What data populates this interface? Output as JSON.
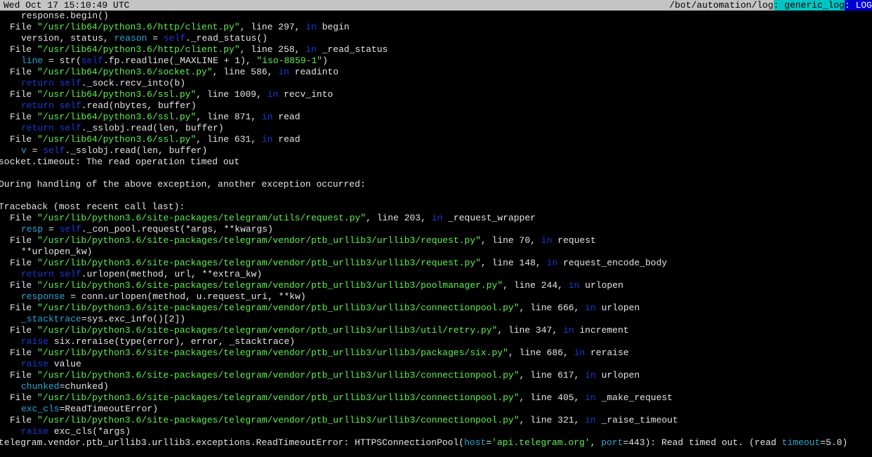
{
  "status_bar": {
    "datetime": "Wed Oct 17 15:10:49 UTC",
    "path": "/bot/automation/log",
    "sep1": ":",
    "window": " generic_log",
    "sep2": ":",
    "tag": " LOG"
  },
  "colors": {
    "string": "#5ff050",
    "keyword": "#1a3ad8",
    "variable": "#2aa8d8",
    "text": "#e5e5e5",
    "background": "#000000"
  },
  "lines": [
    {
      "indent": 4,
      "parts": [
        {
          "t": "response.begin()"
        }
      ]
    },
    {
      "indent": 2,
      "parts": [
        {
          "t": "File "
        },
        {
          "t": "\"/usr/lib64/python3.6/http/client.py\"",
          "c": "str"
        },
        {
          "t": ", line 297, "
        },
        {
          "t": "in",
          "c": "kw"
        },
        {
          "t": " begin"
        }
      ]
    },
    {
      "indent": 4,
      "parts": [
        {
          "t": "version, status, "
        },
        {
          "t": "reason",
          "c": "var"
        },
        {
          "t": " = "
        },
        {
          "t": "self",
          "c": "self"
        },
        {
          "t": "._read_status()"
        }
      ]
    },
    {
      "indent": 2,
      "parts": [
        {
          "t": "File "
        },
        {
          "t": "\"/usr/lib64/python3.6/http/client.py\"",
          "c": "str"
        },
        {
          "t": ", line 258, "
        },
        {
          "t": "in",
          "c": "kw"
        },
        {
          "t": " _read_status"
        }
      ]
    },
    {
      "indent": 4,
      "parts": [
        {
          "t": "line",
          "c": "var"
        },
        {
          "t": " = str("
        },
        {
          "t": "self",
          "c": "self"
        },
        {
          "t": ".fp.readline(_MAXLINE + 1), "
        },
        {
          "t": "\"iso-8859-1\"",
          "c": "str"
        },
        {
          "t": ")"
        }
      ]
    },
    {
      "indent": 2,
      "parts": [
        {
          "t": "File "
        },
        {
          "t": "\"/usr/lib64/python3.6/socket.py\"",
          "c": "str"
        },
        {
          "t": ", line 586, "
        },
        {
          "t": "in",
          "c": "kw"
        },
        {
          "t": " readinto"
        }
      ]
    },
    {
      "indent": 4,
      "parts": [
        {
          "t": "return",
          "c": "kw"
        },
        {
          "t": " "
        },
        {
          "t": "self",
          "c": "self"
        },
        {
          "t": "._sock.recv_into(b)"
        }
      ]
    },
    {
      "indent": 2,
      "parts": [
        {
          "t": "File "
        },
        {
          "t": "\"/usr/lib64/python3.6/ssl.py\"",
          "c": "str"
        },
        {
          "t": ", line 1009, "
        },
        {
          "t": "in",
          "c": "kw"
        },
        {
          "t": " recv_into"
        }
      ]
    },
    {
      "indent": 4,
      "parts": [
        {
          "t": "return",
          "c": "kw"
        },
        {
          "t": " "
        },
        {
          "t": "self",
          "c": "self"
        },
        {
          "t": ".read(nbytes, buffer)"
        }
      ]
    },
    {
      "indent": 2,
      "parts": [
        {
          "t": "File "
        },
        {
          "t": "\"/usr/lib64/python3.6/ssl.py\"",
          "c": "str"
        },
        {
          "t": ", line 871, "
        },
        {
          "t": "in",
          "c": "kw"
        },
        {
          "t": " read"
        }
      ]
    },
    {
      "indent": 4,
      "parts": [
        {
          "t": "return",
          "c": "kw"
        },
        {
          "t": " "
        },
        {
          "t": "self",
          "c": "self"
        },
        {
          "t": "._sslobj.read(len, buffer)"
        }
      ]
    },
    {
      "indent": 2,
      "parts": [
        {
          "t": "File "
        },
        {
          "t": "\"/usr/lib64/python3.6/ssl.py\"",
          "c": "str"
        },
        {
          "t": ", line 631, "
        },
        {
          "t": "in",
          "c": "kw"
        },
        {
          "t": " read"
        }
      ]
    },
    {
      "indent": 4,
      "parts": [
        {
          "t": "v",
          "c": "var"
        },
        {
          "t": " = "
        },
        {
          "t": "self",
          "c": "self"
        },
        {
          "t": "._sslobj.read(len, buffer)"
        }
      ]
    },
    {
      "indent": 0,
      "parts": [
        {
          "t": "socket.timeout: The read operation timed out"
        }
      ]
    },
    {
      "indent": 0,
      "parts": [
        {
          "t": ""
        }
      ]
    },
    {
      "indent": 0,
      "parts": [
        {
          "t": "During handling of the above exception, another exception occurred:"
        }
      ]
    },
    {
      "indent": 0,
      "parts": [
        {
          "t": ""
        }
      ]
    },
    {
      "indent": 0,
      "parts": [
        {
          "t": "Traceback (most recent call last):"
        }
      ]
    },
    {
      "indent": 2,
      "parts": [
        {
          "t": "File "
        },
        {
          "t": "\"/usr/lib/python3.6/site-packages/telegram/utils/request.py\"",
          "c": "str"
        },
        {
          "t": ", line 203, "
        },
        {
          "t": "in",
          "c": "kw"
        },
        {
          "t": " _request_wrapper"
        }
      ]
    },
    {
      "indent": 4,
      "parts": [
        {
          "t": "resp",
          "c": "var"
        },
        {
          "t": " = "
        },
        {
          "t": "self",
          "c": "self"
        },
        {
          "t": "._con_pool.request(*args, **kwargs)"
        }
      ]
    },
    {
      "indent": 2,
      "parts": [
        {
          "t": "File "
        },
        {
          "t": "\"/usr/lib/python3.6/site-packages/telegram/vendor/ptb_urllib3/urllib3/request.py\"",
          "c": "str"
        },
        {
          "t": ", line 70, "
        },
        {
          "t": "in",
          "c": "kw"
        },
        {
          "t": " request"
        }
      ]
    },
    {
      "indent": 4,
      "parts": [
        {
          "t": "**urlopen_kw)"
        }
      ]
    },
    {
      "indent": 2,
      "parts": [
        {
          "t": "File "
        },
        {
          "t": "\"/usr/lib/python3.6/site-packages/telegram/vendor/ptb_urllib3/urllib3/request.py\"",
          "c": "str"
        },
        {
          "t": ", line 148, "
        },
        {
          "t": "in",
          "c": "kw"
        },
        {
          "t": " request_encode_body"
        }
      ]
    },
    {
      "indent": 4,
      "parts": [
        {
          "t": "return",
          "c": "kw"
        },
        {
          "t": " "
        },
        {
          "t": "self",
          "c": "self"
        },
        {
          "t": ".urlopen(method, url, **extra_kw)"
        }
      ]
    },
    {
      "indent": 2,
      "parts": [
        {
          "t": "File "
        },
        {
          "t": "\"/usr/lib/python3.6/site-packages/telegram/vendor/ptb_urllib3/urllib3/poolmanager.py\"",
          "c": "str"
        },
        {
          "t": ", line 244, "
        },
        {
          "t": "in",
          "c": "kw"
        },
        {
          "t": " urlopen"
        }
      ]
    },
    {
      "indent": 4,
      "parts": [
        {
          "t": "response",
          "c": "var"
        },
        {
          "t": " = conn.urlopen(method, u.request_uri, **kw)"
        }
      ]
    },
    {
      "indent": 2,
      "parts": [
        {
          "t": "File "
        },
        {
          "t": "\"/usr/lib/python3.6/site-packages/telegram/vendor/ptb_urllib3/urllib3/connectionpool.py\"",
          "c": "str"
        },
        {
          "t": ", line 666, "
        },
        {
          "t": "in",
          "c": "kw"
        },
        {
          "t": " urlopen"
        }
      ]
    },
    {
      "indent": 4,
      "parts": [
        {
          "t": "_stacktrace",
          "c": "var"
        },
        {
          "t": "=sys.exc_info()[2])"
        }
      ]
    },
    {
      "indent": 2,
      "parts": [
        {
          "t": "File "
        },
        {
          "t": "\"/usr/lib/python3.6/site-packages/telegram/vendor/ptb_urllib3/urllib3/util/retry.py\"",
          "c": "str"
        },
        {
          "t": ", line 347, "
        },
        {
          "t": "in",
          "c": "kw"
        },
        {
          "t": " increment"
        }
      ]
    },
    {
      "indent": 4,
      "parts": [
        {
          "t": "raise",
          "c": "kw"
        },
        {
          "t": " six.reraise(type(error), error, _stacktrace)"
        }
      ]
    },
    {
      "indent": 2,
      "parts": [
        {
          "t": "File "
        },
        {
          "t": "\"/usr/lib/python3.6/site-packages/telegram/vendor/ptb_urllib3/urllib3/packages/six.py\"",
          "c": "str"
        },
        {
          "t": ", line 686, "
        },
        {
          "t": "in",
          "c": "kw"
        },
        {
          "t": " reraise"
        }
      ]
    },
    {
      "indent": 4,
      "parts": [
        {
          "t": "raise",
          "c": "kw"
        },
        {
          "t": " value"
        }
      ]
    },
    {
      "indent": 2,
      "parts": [
        {
          "t": "File "
        },
        {
          "t": "\"/usr/lib/python3.6/site-packages/telegram/vendor/ptb_urllib3/urllib3/connectionpool.py\"",
          "c": "str"
        },
        {
          "t": ", line 617, "
        },
        {
          "t": "in",
          "c": "kw"
        },
        {
          "t": " urlopen"
        }
      ]
    },
    {
      "indent": 4,
      "parts": [
        {
          "t": "chunked",
          "c": "var"
        },
        {
          "t": "=chunked)"
        }
      ]
    },
    {
      "indent": 2,
      "parts": [
        {
          "t": "File "
        },
        {
          "t": "\"/usr/lib/python3.6/site-packages/telegram/vendor/ptb_urllib3/urllib3/connectionpool.py\"",
          "c": "str"
        },
        {
          "t": ", line 405, "
        },
        {
          "t": "in",
          "c": "kw"
        },
        {
          "t": " _make_request"
        }
      ]
    },
    {
      "indent": 4,
      "parts": [
        {
          "t": "exc_cls",
          "c": "var"
        },
        {
          "t": "=ReadTimeoutError)"
        }
      ]
    },
    {
      "indent": 2,
      "parts": [
        {
          "t": "File "
        },
        {
          "t": "\"/usr/lib/python3.6/site-packages/telegram/vendor/ptb_urllib3/urllib3/connectionpool.py\"",
          "c": "str"
        },
        {
          "t": ", line 321, "
        },
        {
          "t": "in",
          "c": "kw"
        },
        {
          "t": " _raise_timeout"
        }
      ]
    },
    {
      "indent": 4,
      "parts": [
        {
          "t": "raise",
          "c": "kw"
        },
        {
          "t": " exc_cls(*args)"
        }
      ]
    },
    {
      "indent": 0,
      "parts": [
        {
          "t": "telegram.vendor.ptb_urllib3.urllib3.exceptions.ReadTimeoutError: HTTPSConnectionPool("
        },
        {
          "t": "host",
          "c": "var"
        },
        {
          "t": "="
        },
        {
          "t": "'api.telegram.org'",
          "c": "str"
        },
        {
          "t": ", "
        },
        {
          "t": "port",
          "c": "var"
        },
        {
          "t": "=443): Read timed out. (read "
        },
        {
          "t": "timeout",
          "c": "var"
        },
        {
          "t": "=5.0)"
        }
      ]
    }
  ]
}
